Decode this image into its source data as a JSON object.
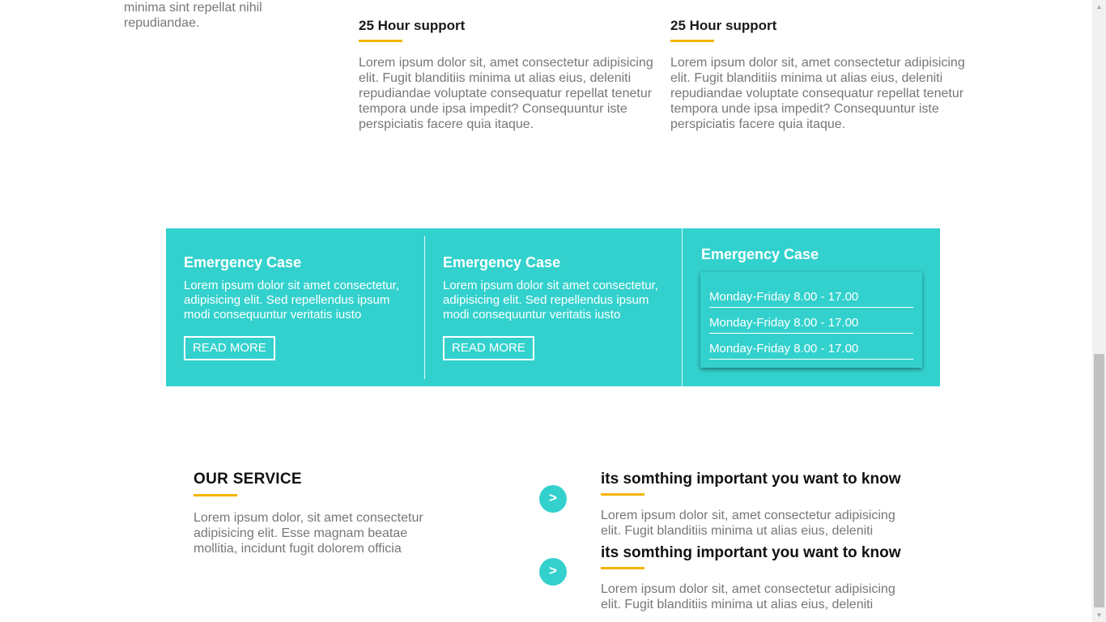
{
  "top": {
    "fragment_text": "minima sint repellat nihil repudiandae."
  },
  "support": [
    {
      "title": "25 Hour support",
      "text": "Lorem ipsum dolor sit, amet consectetur adipisicing elit. Fugit blanditiis minima ut alias eius, deleniti repudiandae voluptate consequatur repellat tenetur tempora unde ipsa impedit? Consequuntur iste perspiciatis facere quia itaque."
    },
    {
      "title": "25 Hour support",
      "text": "Lorem ipsum dolor sit, amet consectetur adipisicing elit. Fugit blanditiis minima ut alias eius, deleniti repudiandae voluptate consequatur repellat tenetur tempora unde ipsa impedit? Consequuntur iste perspiciatis facere quia itaque."
    }
  ],
  "emergency": {
    "cards": [
      {
        "title": "Emergency Case",
        "text": "Lorem ipsum dolor sit amet consectetur, adipisicing elit. Sed repellendus ipsum modi consequuntur veritatis iusto",
        "button": "READ MORE"
      },
      {
        "title": "Emergency Case",
        "text": "Lorem ipsum dolor sit amet consectetur, adipisicing elit. Sed repellendus ipsum modi consequuntur veritatis iusto",
        "button": "READ MORE"
      }
    ],
    "hours": {
      "title": "Emergency Case",
      "rows": [
        "Monday-Friday 8.00 - 17.00",
        "Monday-Friday 8.00 - 17.00",
        "Monday-Friday 8.00 - 17.00"
      ]
    }
  },
  "service": {
    "title": "OUR SERVICE",
    "text": "Lorem ipsum dolor, sit amet consectetur adipisicing elit. Esse magnam beatae mollitia, incidunt fugit dolorem officia",
    "items": [
      {
        "arrow": ">",
        "title": "its somthing important you want to know",
        "text": "Lorem ipsum dolor sit, amet consectetur adipisicing elit. Fugit blanditiis minima ut alias eius, deleniti"
      },
      {
        "arrow": ">",
        "title": "its somthing important you want to know",
        "text": "Lorem ipsum dolor sit, amet consectetur adipisicing elit. Fugit blanditiis minima ut alias eius, deleniti"
      }
    ]
  },
  "colors": {
    "accent_teal": "#33d1cd",
    "accent_yellow": "#f5b400",
    "text_gray": "#777777"
  }
}
